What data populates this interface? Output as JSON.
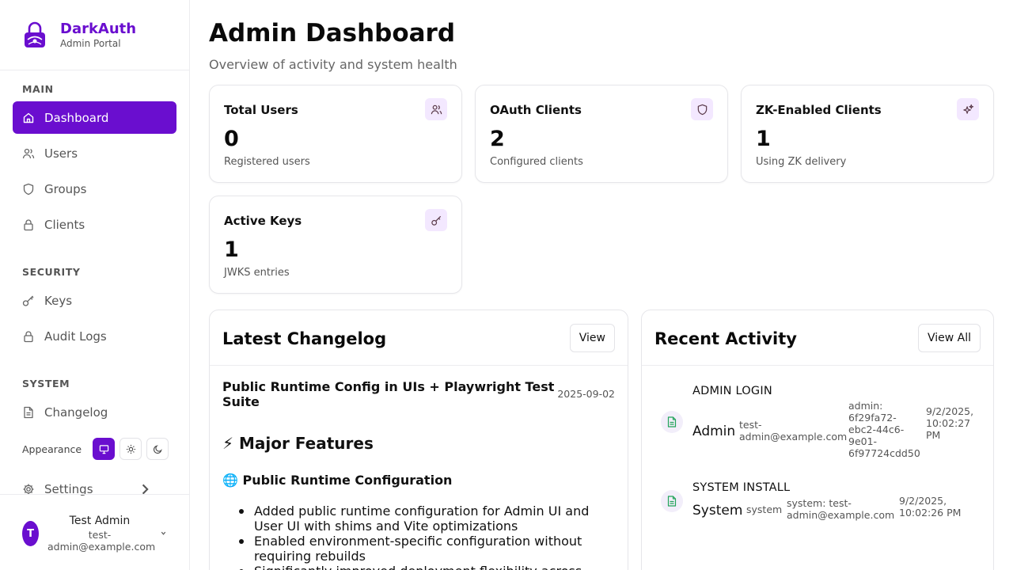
{
  "brand": {
    "name": "DarkAuth",
    "subtitle": "Admin Portal"
  },
  "nav": {
    "sections": [
      "MAIN",
      "SECURITY",
      "SYSTEM"
    ],
    "items": [
      {
        "label": "Dashboard",
        "icon": "home-icon",
        "active": true
      },
      {
        "label": "Users",
        "icon": "users-icon"
      },
      {
        "label": "Groups",
        "icon": "shield-icon"
      },
      {
        "label": "Clients",
        "icon": "lock-icon"
      },
      {
        "label": "Keys",
        "icon": "key-icon"
      },
      {
        "label": "Audit Logs",
        "icon": "lock-icon"
      },
      {
        "label": "Changelog",
        "icon": "document-icon"
      },
      {
        "label": "Settings",
        "icon": "gear-icon"
      }
    ],
    "appearance_label": "Appearance",
    "appearance_modes": [
      "system",
      "light",
      "dark"
    ],
    "appearance_selected": "system"
  },
  "user": {
    "initial": "T",
    "name": "Test Admin",
    "email": "test-admin@example.com"
  },
  "header": {
    "title": "Admin Dashboard",
    "subtitle": "Overview of activity and system health"
  },
  "stats": [
    {
      "title": "Total Users",
      "value": "0",
      "caption": "Registered users",
      "icon": "users-icon"
    },
    {
      "title": "OAuth Clients",
      "value": "2",
      "caption": "Configured clients",
      "icon": "shield-icon"
    },
    {
      "title": "ZK-Enabled Clients",
      "value": "1",
      "caption": "Using ZK delivery",
      "icon": "sparkles-icon"
    },
    {
      "title": "Active Keys",
      "value": "1",
      "caption": "JWKS entries",
      "icon": "key-icon"
    }
  ],
  "changelog": {
    "title": "Latest Changelog",
    "button": "View",
    "entry_title": "Public Runtime Config in UIs + Playwright Test Suite",
    "entry_date": "2025-09-02",
    "heading": "⚡ Major Features",
    "subheading": "🌐 Public Runtime Configuration",
    "bullets": [
      "Added public runtime configuration for Admin UI and User UI with shims and Vite optimizations",
      "Enabled environment-specific configuration without requiring rebuilds",
      "Significantly improved deployment flexibility across"
    ]
  },
  "activity": {
    "title": "Recent Activity",
    "button": "View All",
    "items": [
      {
        "type": "ADMIN LOGIN",
        "actor": "Admin",
        "email": "test-admin@example.com",
        "detail": "admin: 6f29fa72-ebc2-44c6-9e01-6f97724cdd50",
        "time": "9/2/2025, 10:02:27 PM",
        "icon": "document-icon"
      },
      {
        "type": "SYSTEM INSTALL",
        "actor": "System",
        "email": "system",
        "detail": "system: test-admin@example.com",
        "time": "9/2/2025, 10:02:26 PM",
        "icon": "document-icon"
      }
    ]
  },
  "colors": {
    "accent": "#6a0ecf",
    "icon_bg": "#f3e8ff",
    "activity_icon": "#22a35a"
  }
}
